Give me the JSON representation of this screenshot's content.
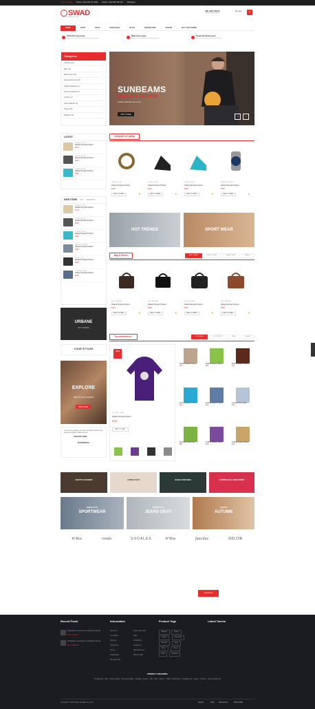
{
  "topbar": {
    "free_shipping": "Free Shipping",
    "phone": "Phone: 0123 456 78 | SMS",
    "hotline": "Hotline: 0123 456 789 123",
    "whatsapp": "Whatsapp"
  },
  "header": {
    "logo": "SWAD",
    "logo_sub": "THE NO.1 FASHION STORE",
    "welcome": "WE ARE TODAY",
    "welcome_sub": "Enter login or Sign up",
    "my_cart": "My cart",
    "cart_count": "0"
  },
  "nav": {
    "items": [
      "HOME",
      "SHOP",
      "PAGE",
      "PORTFOLIO",
      "BLOG",
      "SHORTCODE",
      "FORUM",
      "BUY THIS THEME"
    ]
  },
  "features": [
    {
      "title": "100% full responsive",
      "desc": "Design is used Yeti built of the frontend responsive"
    },
    {
      "title": "Multi home page",
      "desc": "Best styling with different homepage layouts"
    },
    {
      "title": "Powerfull admin panel",
      "desc": "We have advanced admin panel offering"
    }
  ],
  "categories": {
    "title": "Categories",
    "items": [
      "Clothing (12)",
      "Bag (10)",
      "Electronics (10)",
      "Game electronics (2)",
      "Health & Beauty (4)",
      "Home & Garden (2)",
      "Jewelry (2)",
      "Kids & Babies (3)",
      "Shoes (10)",
      "Watches (2)"
    ]
  },
  "banner": {
    "title": "SUNBEAMS",
    "subtitle": "MARKET DESIGN",
    "desc": "Fashion is that which you are not",
    "button": "VISIT STORE"
  },
  "latest": {
    "title": "LATEST",
    "items": [
      {
        "cat": "JEWELRY, RING",
        "name": "Default Simple Product",
        "price": "$222"
      },
      {
        "cat": "PUMPS, SHOES",
        "name": "Default Simple Product",
        "price": "$222",
        "old": "$333"
      },
      {
        "cat": "PUMPS, SHOES",
        "name": "Default Simple Product",
        "price": "$250"
      }
    ]
  },
  "new_items": {
    "tabs": [
      "NEW ITEMS",
      "HOT",
      "SPECIALS"
    ],
    "items": [
      {
        "cat": "JEWELRY, RING",
        "name": "Default Simple Product",
        "price": "$222"
      },
      {
        "cat": "PUMPS, SHOES",
        "name": "Default Simple Product",
        "price": "$222"
      },
      {
        "cat": "PUMPS, SHOES",
        "name": "Default Simple Product",
        "price": "$250"
      },
      {
        "cat": "WATCHES, WATCH",
        "name": "Default Simple Product",
        "price": "$250"
      },
      {
        "cat": "SHOES, TOP",
        "name": "Default Simple Product",
        "price": "$250"
      },
      {
        "cat": "CLOTHING, SHIRT",
        "name": "Default Simple Product",
        "price": "$250"
      }
    ]
  },
  "computer_section": {
    "title": "Computer & Laptop",
    "products": [
      {
        "cat": "JEWELRY, RING",
        "name": "Default Simple Product",
        "price": "$222",
        "add": "ADD TO CART"
      },
      {
        "cat": "PUMPS, SHOES",
        "name": "Default Simple Product",
        "price": "$222",
        "old": "$333",
        "add": "ADD TO CART"
      },
      {
        "cat": "PUMPS, SHOES",
        "name": "Default Simple Product",
        "price": "$250",
        "add": "ADD TO CART"
      },
      {
        "cat": "WATCHES, WATCH",
        "name": "Default Simple Product",
        "price": "$250",
        "add": "ADD TO CART"
      }
    ]
  },
  "promos": {
    "hot": "HOT TRENDS",
    "sport": "SPORT WEAR"
  },
  "bag_section": {
    "title": "Bag & Shoes",
    "tabs": [
      "NEW ITEMS",
      "MOST ITEMS",
      "SALE ITEMS",
      "SHIRTS"
    ],
    "products": [
      {
        "cat": "BAG, HANDBAG",
        "name": "Default Simple Product",
        "price": "$222",
        "add": "ADD TO CART"
      },
      {
        "cat": "BAG, HANDBAG",
        "name": "Default Simple Product",
        "price": "$250",
        "add": "ADD TO CART"
      },
      {
        "cat": "BAG, HANDBAG",
        "name": "Default Simple Product",
        "price": "$250",
        "add": "ADD TO CART"
      },
      {
        "cat": "BAG, HANDBAG",
        "name": "Default Simple Product",
        "price": "$250",
        "add": "ADD TO CART"
      }
    ]
  },
  "urbane": {
    "title": "URBANE",
    "sub": "CITY ESCAPE"
  },
  "your_styles": {
    "title": "YOUR STYLES",
    "explore": "EXPLORE",
    "sub": "NEW STYLES & TRENDS",
    "btn": "SHOP NOW"
  },
  "testimonial": {
    "text": "I do not buy anything. You have so amazing theme and awesome support. Thanks to you!",
    "author": "JOHN WILLIAMS",
    "label": "TESTIMONIAL"
  },
  "top_section": {
    "title": "Top recommend !",
    "tabs": [
      "CLOTHING",
      "ELECTRONIC",
      "BAG",
      "SHOES"
    ],
    "featured": {
      "badge": "SALE",
      "cat": "CLOTHING, SHIRT",
      "name": "Default Simple Product",
      "price": "$250",
      "add": "ADD TO CART"
    },
    "grid": [
      {
        "name": "Default Simple Product",
        "price": "$15",
        "old": "$11"
      },
      {
        "name": "Default Simple Product",
        "price": "$59",
        "old": "$11"
      },
      {
        "name": "Default Simple Product",
        "price": "$49",
        "old": "$11"
      },
      {
        "name": "Default Simple Product",
        "price": "$22"
      },
      {
        "name": "Default Simple Product",
        "price": "$22"
      },
      {
        "name": "Group Product Right",
        "price": "$39"
      },
      {
        "name": "External Product Left",
        "price": "$59"
      },
      {
        "name": "Default Simple Product",
        "price": "$24"
      },
      {
        "name": "Default Simple Product",
        "price": "$72"
      }
    ]
  },
  "categories_promo": [
    {
      "label": "BOOTS FASHION"
    },
    {
      "label": "LINEN COAT"
    },
    {
      "label": "BAGS FOR MEN"
    },
    {
      "label": "CARDIGAN & SWEATERS"
    }
  ],
  "styles_promo": [
    {
      "label": "SPORTWEAR",
      "sub": "ONESTYLE"
    },
    {
      "label": "JEANS GRAY",
      "sub": "NEWSTYLE"
    },
    {
      "label": "AUTUMN",
      "sub": "COATS"
    }
  ],
  "brands": [
    "W'Ros",
    "vendo",
    "SODALES",
    "W'Ros",
    "fancilus",
    "DECÖR"
  ],
  "subscribe": "Subscribe",
  "footer": {
    "recent_posts": "Recent Posts",
    "information": "Information",
    "product_tags": "Product Tags",
    "latest_tweets": "Latest Tweets",
    "posts": [
      {
        "title": "Voluptatem accusantium laudantium aperia",
        "by": "Post by Dehau"
      },
      {
        "title": "Voluptatem accusantium laudantium aperia",
        "by": "Post by Dehau"
      }
    ],
    "info_col1": [
      "About Us",
      "Our offices",
      "Delivery",
      "Contact Us",
      "Stores",
      "Sustainable",
      "Buy gift cards",
      "Warranty",
      "Returns"
    ],
    "info_col2": [
      "Track your order",
      "Faqs",
      "Conditions",
      "Contact us",
      "Manufacturers",
      "New Arrivals",
      "Specials"
    ],
    "tags": [
      "Aliquam",
      "Laptop",
      "Leather",
      "Monitoring",
      "Fashion",
      "Sport",
      "Shirts",
      "Shoes",
      "Sale",
      "Watches"
    ],
    "product_categories": "PRODUCT CATEGORIES",
    "cat_links": "Smartphone · Bag · Women Bags · Movement Bags · Clothing · Sports · Kids · Men · Shoes · T-Shirt · Electronics · Headphones · Laptop · Phones · Game electronics",
    "copyright": "Copyright © 2016 Swad. All rights reserved.",
    "payments": [
      "PayPal",
      "VISA",
      "MasterCard",
      "DISCOVER"
    ]
  }
}
